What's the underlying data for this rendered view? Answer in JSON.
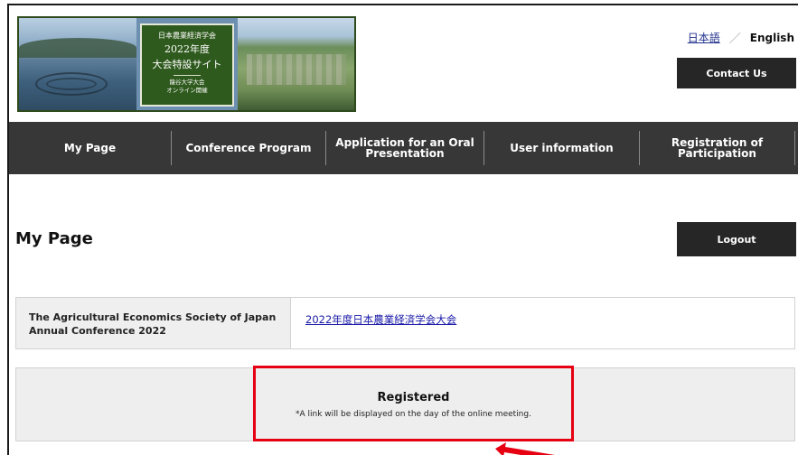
{
  "banner": {
    "line1": "日本農業経済学会",
    "line2": "2022年度",
    "line3": "大会特設サイト",
    "line4": "龍谷大学大会",
    "line5": "オンライン開催"
  },
  "language": {
    "japanese": "日本語",
    "separator": "／",
    "english": "English"
  },
  "header": {
    "contact_label": "Contact Us"
  },
  "nav": {
    "items": [
      {
        "label": "My Page"
      },
      {
        "label": "Conference Program"
      },
      {
        "label": "Application for an Oral Presentation"
      },
      {
        "label": "User information"
      },
      {
        "label": "Registration of Participation"
      }
    ]
  },
  "main": {
    "title": "My Page",
    "logout_label": "Logout",
    "conference": {
      "label": "The Agricultural Economics Society of Japan Annual Conference 2022",
      "link_text": "2022年度日本農業経済学会大会"
    },
    "status": {
      "title": "Registered",
      "note": "*A link will be displayed on the day of the online meeting."
    }
  },
  "colors": {
    "nav_bg": "#373737",
    "button_bg": "#262626",
    "highlight": "#e60012",
    "banner_green": "#2f5a1e",
    "link": "#1a1aa8"
  }
}
